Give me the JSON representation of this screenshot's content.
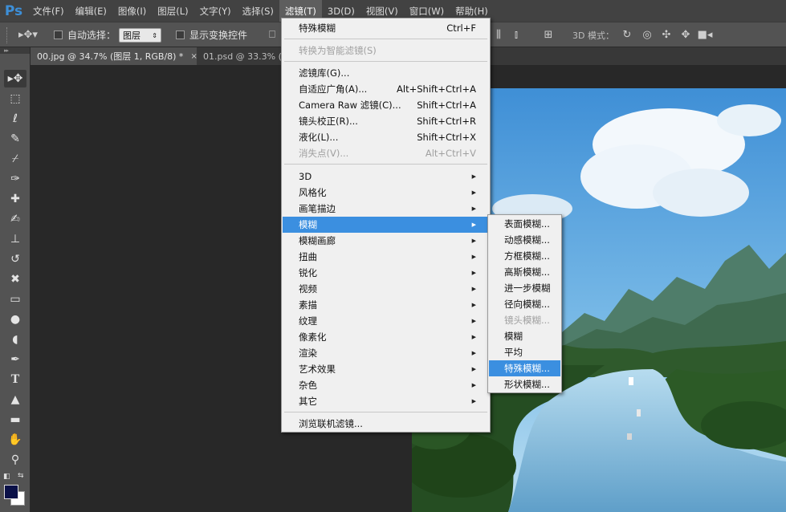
{
  "menubar": {
    "logo": "Ps",
    "items": [
      "文件(F)",
      "编辑(E)",
      "图像(I)",
      "图层(L)",
      "文字(Y)",
      "选择(S)",
      "滤镜(T)",
      "3D(D)",
      "视图(V)",
      "窗口(W)",
      "帮助(H)"
    ],
    "active_index": 6
  },
  "options": {
    "auto_select_label": "自动选择：",
    "auto_select_value": "图层",
    "show_transform_label": "显示变换控件",
    "mode_3d_label": "3D 模式："
  },
  "tabs": [
    {
      "label": "00.jpg @ 34.7% (图层 1, RGB/8) *",
      "close": "×"
    },
    {
      "label": "01.psd @ 33.3% (",
      "close": ""
    }
  ],
  "filter_menu": {
    "items": [
      {
        "label": "特殊模糊",
        "shortcut": "Ctrl+F",
        "disabled": false,
        "submenu": false
      },
      {
        "label": "转换为智能滤镜(S)",
        "shortcut": "",
        "disabled": true,
        "submenu": false
      },
      {
        "label": "滤镜库(G)...",
        "shortcut": "",
        "disabled": false,
        "submenu": false
      },
      {
        "label": "自适应广角(A)...",
        "shortcut": "Alt+Shift+Ctrl+A",
        "disabled": false,
        "submenu": false
      },
      {
        "label": "Camera Raw 滤镜(C)...",
        "shortcut": "Shift+Ctrl+A",
        "disabled": false,
        "submenu": false
      },
      {
        "label": "镜头校正(R)...",
        "shortcut": "Shift+Ctrl+R",
        "disabled": false,
        "submenu": false
      },
      {
        "label": "液化(L)...",
        "shortcut": "Shift+Ctrl+X",
        "disabled": false,
        "submenu": false
      },
      {
        "label": "消失点(V)...",
        "shortcut": "Alt+Ctrl+V",
        "disabled": true,
        "submenu": false
      },
      {
        "label": "3D",
        "shortcut": "",
        "disabled": false,
        "submenu": true
      },
      {
        "label": "风格化",
        "shortcut": "",
        "disabled": false,
        "submenu": true
      },
      {
        "label": "画笔描边",
        "shortcut": "",
        "disabled": false,
        "submenu": true
      },
      {
        "label": "模糊",
        "shortcut": "",
        "disabled": false,
        "submenu": true,
        "highlight": true
      },
      {
        "label": "模糊画廊",
        "shortcut": "",
        "disabled": false,
        "submenu": true
      },
      {
        "label": "扭曲",
        "shortcut": "",
        "disabled": false,
        "submenu": true
      },
      {
        "label": "锐化",
        "shortcut": "",
        "disabled": false,
        "submenu": true
      },
      {
        "label": "视频",
        "shortcut": "",
        "disabled": false,
        "submenu": true
      },
      {
        "label": "素描",
        "shortcut": "",
        "disabled": false,
        "submenu": true
      },
      {
        "label": "纹理",
        "shortcut": "",
        "disabled": false,
        "submenu": true
      },
      {
        "label": "像素化",
        "shortcut": "",
        "disabled": false,
        "submenu": true
      },
      {
        "label": "渲染",
        "shortcut": "",
        "disabled": false,
        "submenu": true
      },
      {
        "label": "艺术效果",
        "shortcut": "",
        "disabled": false,
        "submenu": true
      },
      {
        "label": "杂色",
        "shortcut": "",
        "disabled": false,
        "submenu": true
      },
      {
        "label": "其它",
        "shortcut": "",
        "disabled": false,
        "submenu": true
      },
      {
        "label": "浏览联机滤镜...",
        "shortcut": "",
        "disabled": false,
        "submenu": false
      }
    ]
  },
  "blur_submenu": {
    "items": [
      {
        "label": "表面模糊...",
        "disabled": false
      },
      {
        "label": "动感模糊...",
        "disabled": false
      },
      {
        "label": "方框模糊...",
        "disabled": false
      },
      {
        "label": "高斯模糊...",
        "disabled": false
      },
      {
        "label": "进一步模糊",
        "disabled": false
      },
      {
        "label": "径向模糊...",
        "disabled": false
      },
      {
        "label": "镜头模糊...",
        "disabled": true
      },
      {
        "label": "模糊",
        "disabled": false
      },
      {
        "label": "平均",
        "disabled": false
      },
      {
        "label": "特殊模糊...",
        "disabled": false,
        "highlight": true
      },
      {
        "label": "形状模糊...",
        "disabled": false
      }
    ]
  },
  "colors": {
    "foreground": "#0b1148",
    "background": "#ffffff",
    "highlight": "#3b8fe0"
  }
}
